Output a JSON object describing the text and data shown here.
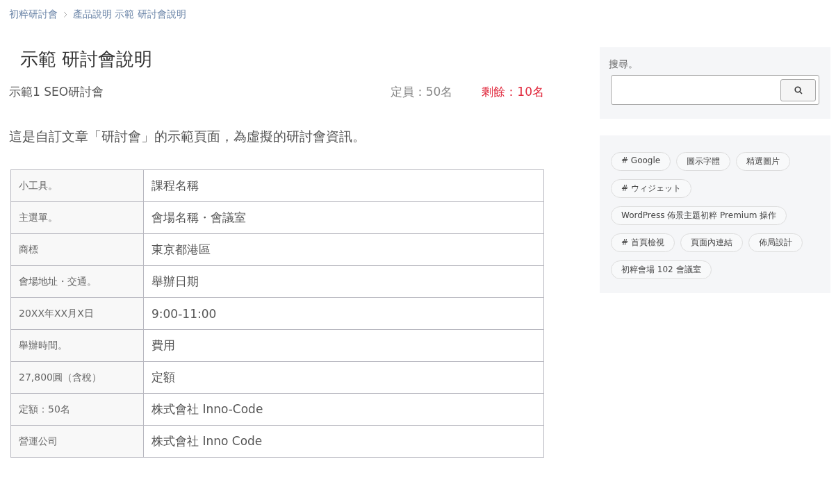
{
  "breadcrumb": [
    {
      "label": "初粹研討會"
    },
    {
      "label": "產品說明 示範 研討會說明"
    }
  ],
  "page_title": "示範 研討會說明",
  "event": {
    "name": "示範1 SEO研討會",
    "capacity": "定員：50名",
    "remaining": "剩餘：10名"
  },
  "description": "這是自訂文章「研討會」的示範頁面，為虛擬的研討會資訊。",
  "table": {
    "rows": [
      {
        "label": "小工具。",
        "value": "課程名稱"
      },
      {
        "label": "主選單。",
        "value": "會場名稱・會議室"
      },
      {
        "label": "商標",
        "value": "東京都港區"
      },
      {
        "label": "會場地址・交通。",
        "value": "舉辦日期"
      },
      {
        "label": "20XX年XX月X日",
        "value": "9:00-11:00"
      },
      {
        "label": "舉辦時間。",
        "value": "費用"
      },
      {
        "label": "27,800圓（含稅）",
        "value": "定額"
      },
      {
        "label": "定額：50名",
        "value": "株式會社 Inno-Code"
      },
      {
        "label": "營運公司",
        "value": "株式會社 Inno Code"
      }
    ]
  },
  "sidebar": {
    "search": {
      "label": "搜尋。"
    },
    "tags": [
      {
        "label": "# Google"
      },
      {
        "label": "圖示字體"
      },
      {
        "label": "精選圖片"
      },
      {
        "label": "# ウィジェット"
      },
      {
        "label": "WordPress 佈景主題初粹 Premium 操作"
      },
      {
        "label": "# 首頁檢視"
      },
      {
        "label": "頁面內連結"
      },
      {
        "label": "佈局設計"
      },
      {
        "label": "初粹會場 102 會議室"
      }
    ]
  }
}
